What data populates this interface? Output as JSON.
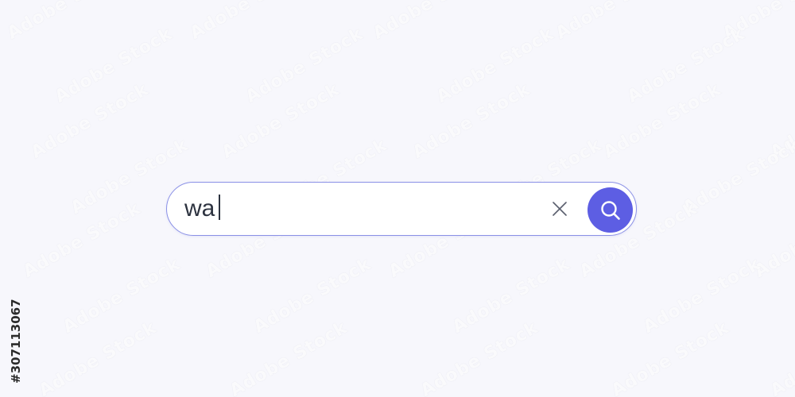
{
  "page": {
    "background_color": "#f7f7fc"
  },
  "search": {
    "query": "wa",
    "clear_icon": "close-icon",
    "submit_icon": "search-icon",
    "accent_color": "#5d5ee3",
    "border_color": "#8a90e6"
  },
  "watermark": {
    "repeated_text": "Adobe Stock",
    "stock_id": "#307113067"
  }
}
